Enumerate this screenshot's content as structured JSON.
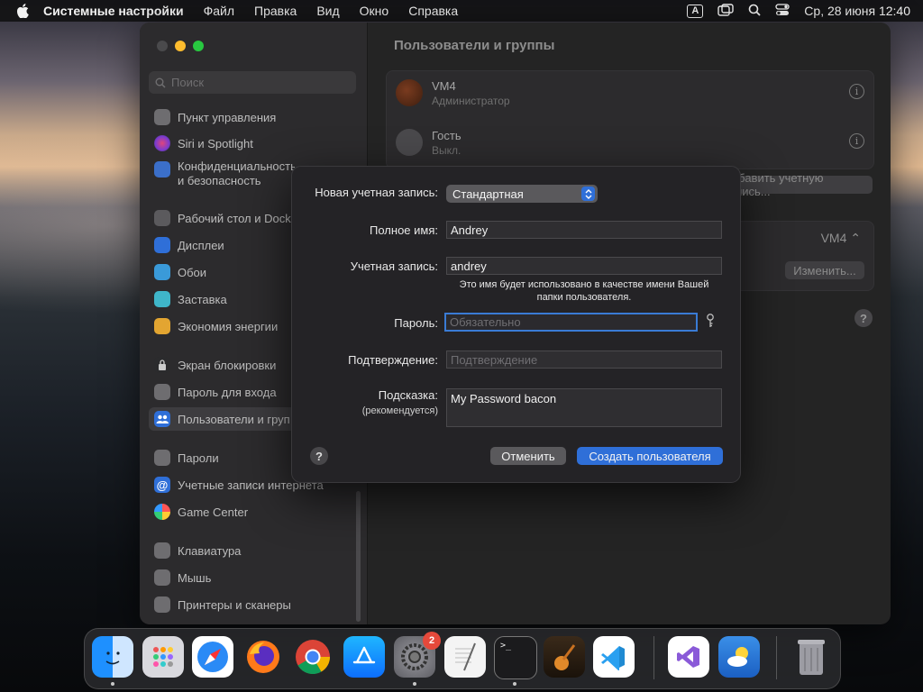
{
  "menubar": {
    "items": [
      "Системные настройки",
      "Файл",
      "Правка",
      "Вид",
      "Окно",
      "Справка"
    ],
    "keyboard_indicator": "A",
    "datetime": "Ср, 28 июня  12:40"
  },
  "sidebar": {
    "search_placeholder": "Поиск",
    "items": [
      {
        "label": "Пункт управления",
        "icon": "control-center-icon"
      },
      {
        "label": "Siri и Spotlight",
        "icon": "siri-icon"
      },
      {
        "label": "Конфиденциальность и безопасность",
        "icon": "privacy-hand-icon"
      },
      {
        "label": "Рабочий стол и Dock",
        "icon": "desktop-dock-icon"
      },
      {
        "label": "Дисплеи",
        "icon": "sun-icon"
      },
      {
        "label": "Обои",
        "icon": "wallpaper-icon"
      },
      {
        "label": "Заставка",
        "icon": "screensaver-icon"
      },
      {
        "label": "Экономия энергии",
        "icon": "bulb-icon"
      },
      {
        "label": "Экран блокировки",
        "icon": "lock-icon"
      },
      {
        "label": "Пароль для входа",
        "icon": "login-password-icon"
      },
      {
        "label": "Пользователи и группы",
        "icon": "users-icon"
      },
      {
        "label": "Пароли",
        "icon": "key-icon"
      },
      {
        "label": "Учетные записи интернета",
        "icon": "at-icon"
      },
      {
        "label": "Game Center",
        "icon": "game-center-icon"
      },
      {
        "label": "Клавиатура",
        "icon": "keyboard-icon"
      },
      {
        "label": "Мышь",
        "icon": "mouse-icon"
      },
      {
        "label": "Принтеры и сканеры",
        "icon": "printer-icon"
      }
    ]
  },
  "main": {
    "title": "Пользователи и группы",
    "users": [
      {
        "name": "VM4",
        "role": "Администратор"
      },
      {
        "name": "Гость",
        "role": "Выкл."
      }
    ],
    "add_account_button": "Добавить учетную запись...",
    "autologin_value": "VM4",
    "edit_button": "Изменить..."
  },
  "dialog": {
    "new_account_label": "Новая учетная запись:",
    "account_type": "Стандартная",
    "full_name_label": "Полное имя:",
    "full_name_value": "Andrey",
    "account_name_label": "Учетная запись:",
    "account_name_value": "andrey",
    "account_hint": "Это имя будет использовано в качестве имени Вашей папки пользователя.",
    "password_label": "Пароль:",
    "password_placeholder": "Обязательно",
    "verify_label": "Подтверждение:",
    "verify_placeholder": "Подтверждение",
    "hint_label": "Подсказка:",
    "hint_sublabel": "(рекомендуется)",
    "hint_value": "My Password bacon",
    "help": "?",
    "cancel_button": "Отменить",
    "create_button": "Создать пользователя"
  },
  "dock": {
    "apps": [
      "finder-icon",
      "launchpad-icon",
      "safari-icon",
      "firefox-icon",
      "chrome-icon",
      "app-store-icon",
      "system-settings-icon",
      "textedit-icon",
      "terminal-icon",
      "garageband-icon",
      "vscode-icon",
      "visual-studio-icon",
      "weather-icon",
      "trash-icon"
    ],
    "settings_badge": "2"
  },
  "colors": {
    "accent": "#2f6fd8",
    "window_bg": "#242424",
    "sidebar_bg": "#2c2b2d"
  }
}
